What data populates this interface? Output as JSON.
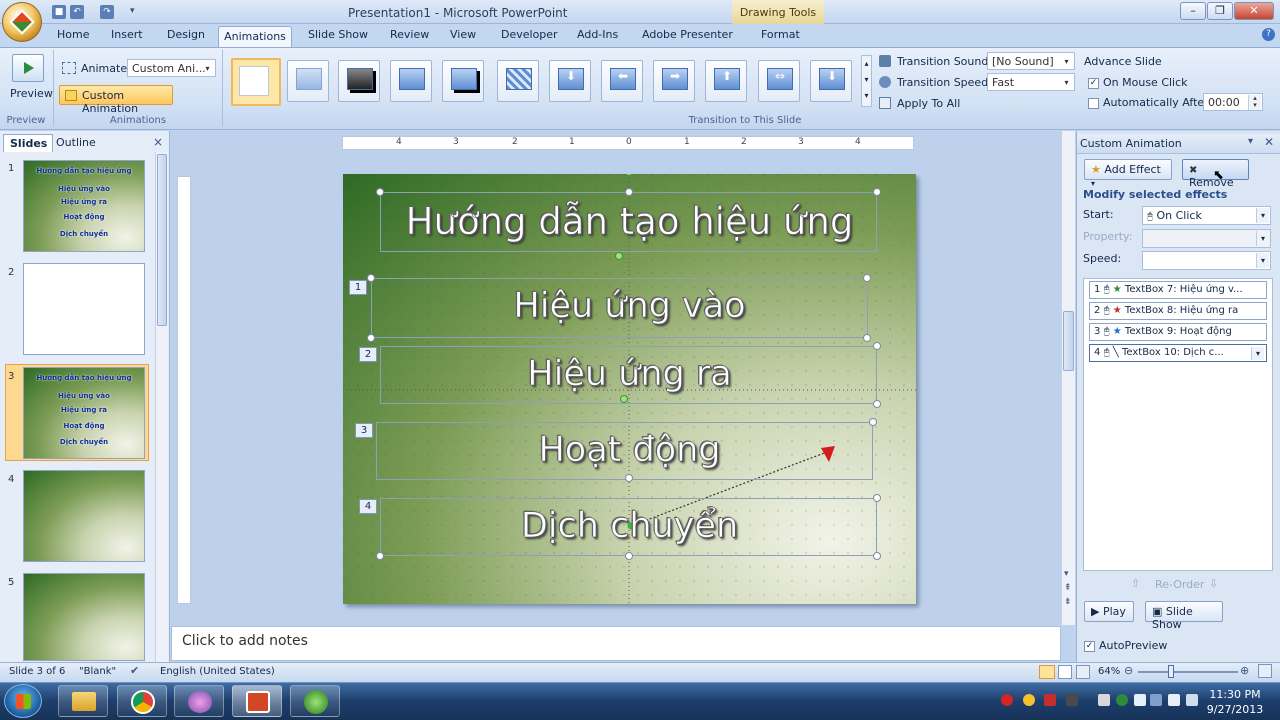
{
  "window": {
    "title": "Presentation1 - Microsoft PowerPoint",
    "context_tab": "Drawing Tools"
  },
  "tabs": [
    "Home",
    "Insert",
    "Design",
    "Animations",
    "Slide Show",
    "Review",
    "View",
    "Developer",
    "Add-Ins",
    "Adobe Presenter",
    "Format"
  ],
  "ribbon": {
    "preview": {
      "label": "Preview",
      "group": "Preview"
    },
    "animations": {
      "animate_label": "Animate:",
      "animate_value": "Custom Ani...",
      "custom_animation": "Custom Animation",
      "group": "Animations"
    },
    "transition": {
      "group": "Transition to This Slide",
      "sound_label": "Transition Sound:",
      "sound_value": "[No Sound]",
      "speed_label": "Transition Speed:",
      "speed_value": "Fast",
      "apply_all": "Apply To All"
    },
    "advance": {
      "title": "Advance Slide",
      "on_click": "On Mouse Click",
      "auto_after": "Automatically After:",
      "auto_value": "00:00"
    }
  },
  "slides_panel": {
    "tabs": [
      "Slides",
      "Outline"
    ],
    "close": "×",
    "slides": [
      {
        "num": "1",
        "lines": [
          "Hướng dẫn tạo hiệu ứng",
          "Hiệu ứng vào",
          "Hiệu ứng ra",
          "Hoạt động",
          "Dịch chuyển"
        ]
      },
      {
        "num": "2",
        "lines": []
      },
      {
        "num": "3",
        "lines": [
          "Hướng dẫn tạo hiệu ứng",
          "Hiệu ứng vào",
          "Hiệu ứng ra",
          "Hoạt động",
          "Dịch chuyển"
        ]
      },
      {
        "num": "4",
        "lines": []
      },
      {
        "num": "5",
        "lines": []
      }
    ]
  },
  "ruler": {
    "h_ticks": [
      "5",
      "4",
      "3",
      "2",
      "1",
      "0",
      "1",
      "2",
      "3",
      "4",
      "5"
    ]
  },
  "slide": {
    "title": "Hướng dẫn tạo hiệu ứng",
    "items": [
      {
        "badge": "1",
        "text": "Hiệu ứng vào"
      },
      {
        "badge": "2",
        "text": "Hiệu ứng ra"
      },
      {
        "badge": "3",
        "text": "Hoạt động"
      },
      {
        "badge": "4",
        "text": "Dịch chuyển"
      }
    ]
  },
  "notes": {
    "placeholder": "Click to add notes"
  },
  "custom_animation": {
    "title": "Custom Animation",
    "add_effect": "Add Effect",
    "remove": "Remove",
    "modify": "Modify selected effects",
    "start_label": "Start:",
    "start_value": "On Click",
    "property_label": "Property:",
    "speed_label": "Speed:",
    "effects": [
      {
        "num": "1",
        "text": "TextBox 7: Hiệu ứng v..."
      },
      {
        "num": "2",
        "text": "TextBox 8: Hiệu ứng ra"
      },
      {
        "num": "3",
        "text": "TextBox 9: Hoạt động"
      },
      {
        "num": "4",
        "text": "TextBox 10: Dịch c..."
      }
    ],
    "reorder": "Re-Order",
    "play": "Play",
    "slide_show": "Slide Show",
    "autopreview": "AutoPreview"
  },
  "status": {
    "slide": "Slide 3 of 6",
    "theme": "\"Blank\"",
    "language": "English (United States)",
    "zoom": "64%"
  },
  "taskbar": {
    "time": "11:30 PM",
    "date": "9/27/2013"
  },
  "colors": {
    "accent": "#f0b85a",
    "ribbon": "#d2e1f4",
    "slide_green": "#2e6a24"
  }
}
